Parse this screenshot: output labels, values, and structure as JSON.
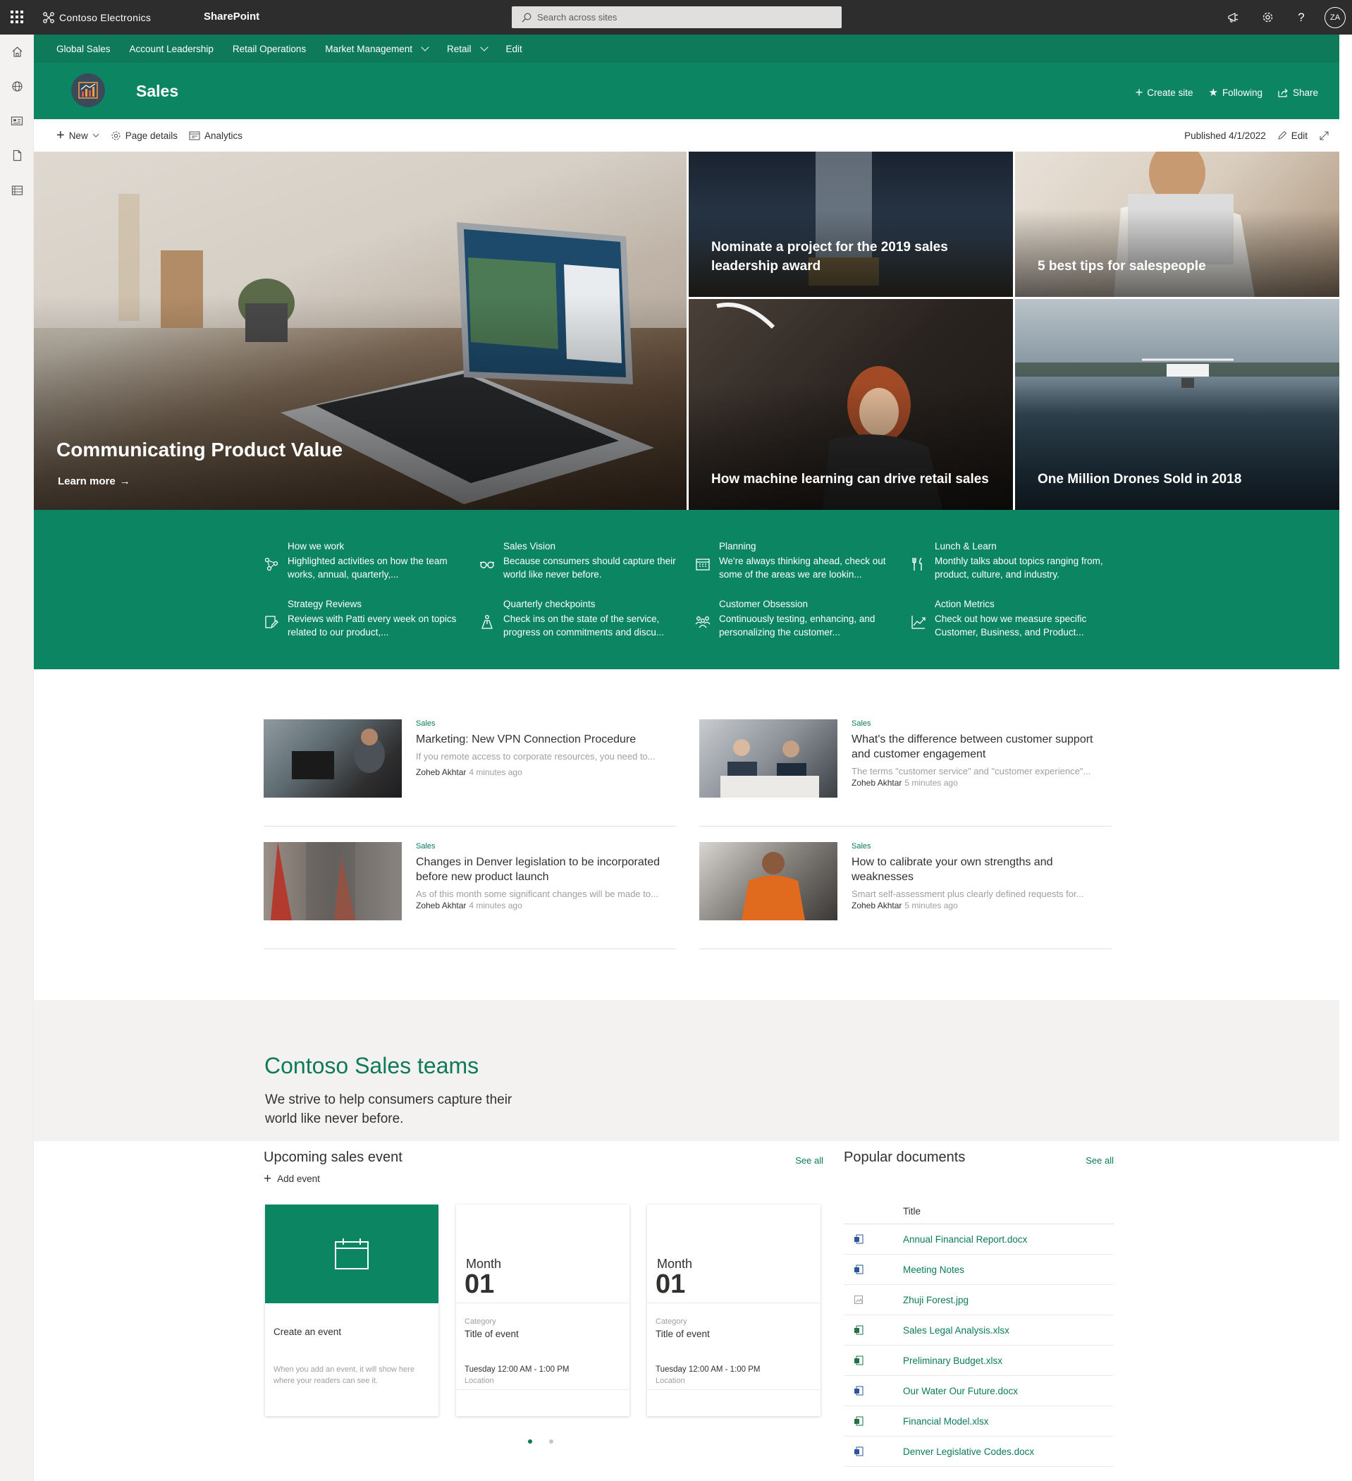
{
  "suitebar": {
    "org_name": "Contoso Electronics",
    "app_name": "SharePoint",
    "search_placeholder": "Search across sites",
    "user_initials": "ZA",
    "icons": [
      "megaphone-icon",
      "gear-icon",
      "help-icon"
    ]
  },
  "leftrail": {
    "icons": [
      "home-icon",
      "globe-icon",
      "news-icon",
      "file-icon",
      "list-icon"
    ]
  },
  "hubnav": {
    "items": [
      {
        "label": "Global Sales",
        "dropdown": false
      },
      {
        "label": "Account Leadership",
        "dropdown": false
      },
      {
        "label": "Retail Operations",
        "dropdown": false
      },
      {
        "label": "Market Management",
        "dropdown": true
      },
      {
        "label": "Retail",
        "dropdown": true
      },
      {
        "label": "Edit",
        "dropdown": false
      }
    ]
  },
  "site": {
    "title": "Sales",
    "create_site": "Create site",
    "following": "Following",
    "share": "Share"
  },
  "commandbar": {
    "new": "New",
    "page_details": "Page details",
    "analytics": "Analytics",
    "published": "Published 4/1/2022",
    "edit": "Edit"
  },
  "hero": {
    "main": {
      "title": "Communicating Product Value",
      "link": "Learn more"
    },
    "tiles": [
      {
        "title": "Nominate a project for the 2019 sales leadership award"
      },
      {
        "title": "5 best tips for salespeople"
      },
      {
        "title": "How machine learning can drive retail sales"
      },
      {
        "title": "One Million Drones Sold in 2018"
      }
    ]
  },
  "quicklinks": [
    {
      "title": "How we work",
      "desc": "Highlighted activities on how the team works, annual, quarterly,...",
      "icon": "people-network-icon"
    },
    {
      "title": "Sales Vision",
      "desc": "Because consumers should capture their world like never before.",
      "icon": "glasses-icon"
    },
    {
      "title": "Planning",
      "desc": "We're always thinking ahead, check out some of the areas we are lookin...",
      "icon": "calendar-icon"
    },
    {
      "title": "Lunch & Learn",
      "desc": "Monthly talks about topics ranging from, product, culture, and industry.",
      "icon": "dining-icon"
    },
    {
      "title": "Strategy Reviews",
      "desc": "Reviews with Patti every week on topics related to our product,...",
      "icon": "edit-note-icon"
    },
    {
      "title": "Quarterly checkpoints",
      "desc": "Check ins on the state of the service, progress on commitments and discu...",
      "icon": "hiking-icon"
    },
    {
      "title": "Customer Obsession",
      "desc": "Continuously testing, enhancing, and personalizing the customer...",
      "icon": "group-icon"
    },
    {
      "title": "Action Metrics",
      "desc": "Check out how we measure specific Customer, Business, and Product...",
      "icon": "chart-line-icon"
    }
  ],
  "news": [
    {
      "category": "Sales",
      "title": "Marketing: New VPN Connection Procedure",
      "desc": "If you remote access to corporate resources, you need to...",
      "author": "Zoheb Akhtar",
      "time": "4 minutes ago"
    },
    {
      "category": "Sales",
      "title": "What's the difference between customer support and customer engagement",
      "desc": "The terms \"customer service\" and \"customer experience\"...",
      "author": "Zoheb Akhtar",
      "time": "5 minutes ago"
    },
    {
      "category": "Sales",
      "title": "Changes in Denver legislation to be incorporated before new product launch",
      "desc": "As of this month some significant changes will be made to...",
      "author": "Zoheb Akhtar",
      "time": "4 minutes ago"
    },
    {
      "category": "Sales",
      "title": "How to calibrate your own strengths and weaknesses",
      "desc": "Smart self-assessment plus clearly defined requests for...",
      "author": "Zoheb Akhtar",
      "time": "5 minutes ago"
    }
  ],
  "teams": {
    "title": "Contoso Sales teams",
    "desc": "We strive to help consumers capture their world like never before."
  },
  "events": {
    "title": "Upcoming sales event",
    "see_all": "See all",
    "add_event": "Add event",
    "create": {
      "title": "Create an event",
      "desc": "When you add an event, it will show here where your readers can see it."
    },
    "cards": [
      {
        "month": "Month",
        "day": "01",
        "category": "Category",
        "title": "Title of event",
        "time": "Tuesday 12:00 AM - 1:00 PM",
        "location": "Location"
      },
      {
        "month": "Month",
        "day": "01",
        "category": "Category",
        "title": "Title of event",
        "time": "Tuesday 12:00 AM - 1:00 PM",
        "location": "Location"
      }
    ]
  },
  "documents": {
    "title": "Popular documents",
    "see_all": "See all",
    "column_title": "Title",
    "items": [
      {
        "name": "Annual Financial Report.docx",
        "type": "word"
      },
      {
        "name": "Meeting Notes",
        "type": "word"
      },
      {
        "name": "Zhuji Forest.jpg",
        "type": "image"
      },
      {
        "name": "Sales Legal Analysis.xlsx",
        "type": "excel"
      },
      {
        "name": "Preliminary Budget.xlsx",
        "type": "excel"
      },
      {
        "name": "Our Water Our Future.docx",
        "type": "word"
      },
      {
        "name": "Financial Model.xlsx",
        "type": "excel"
      },
      {
        "name": "Denver Legislative Codes.docx",
        "type": "word"
      }
    ]
  },
  "colors": {
    "brand_green": "#0b8562",
    "hub_green": "#0e7a5a",
    "suite_bar": "#2d2d2d"
  }
}
